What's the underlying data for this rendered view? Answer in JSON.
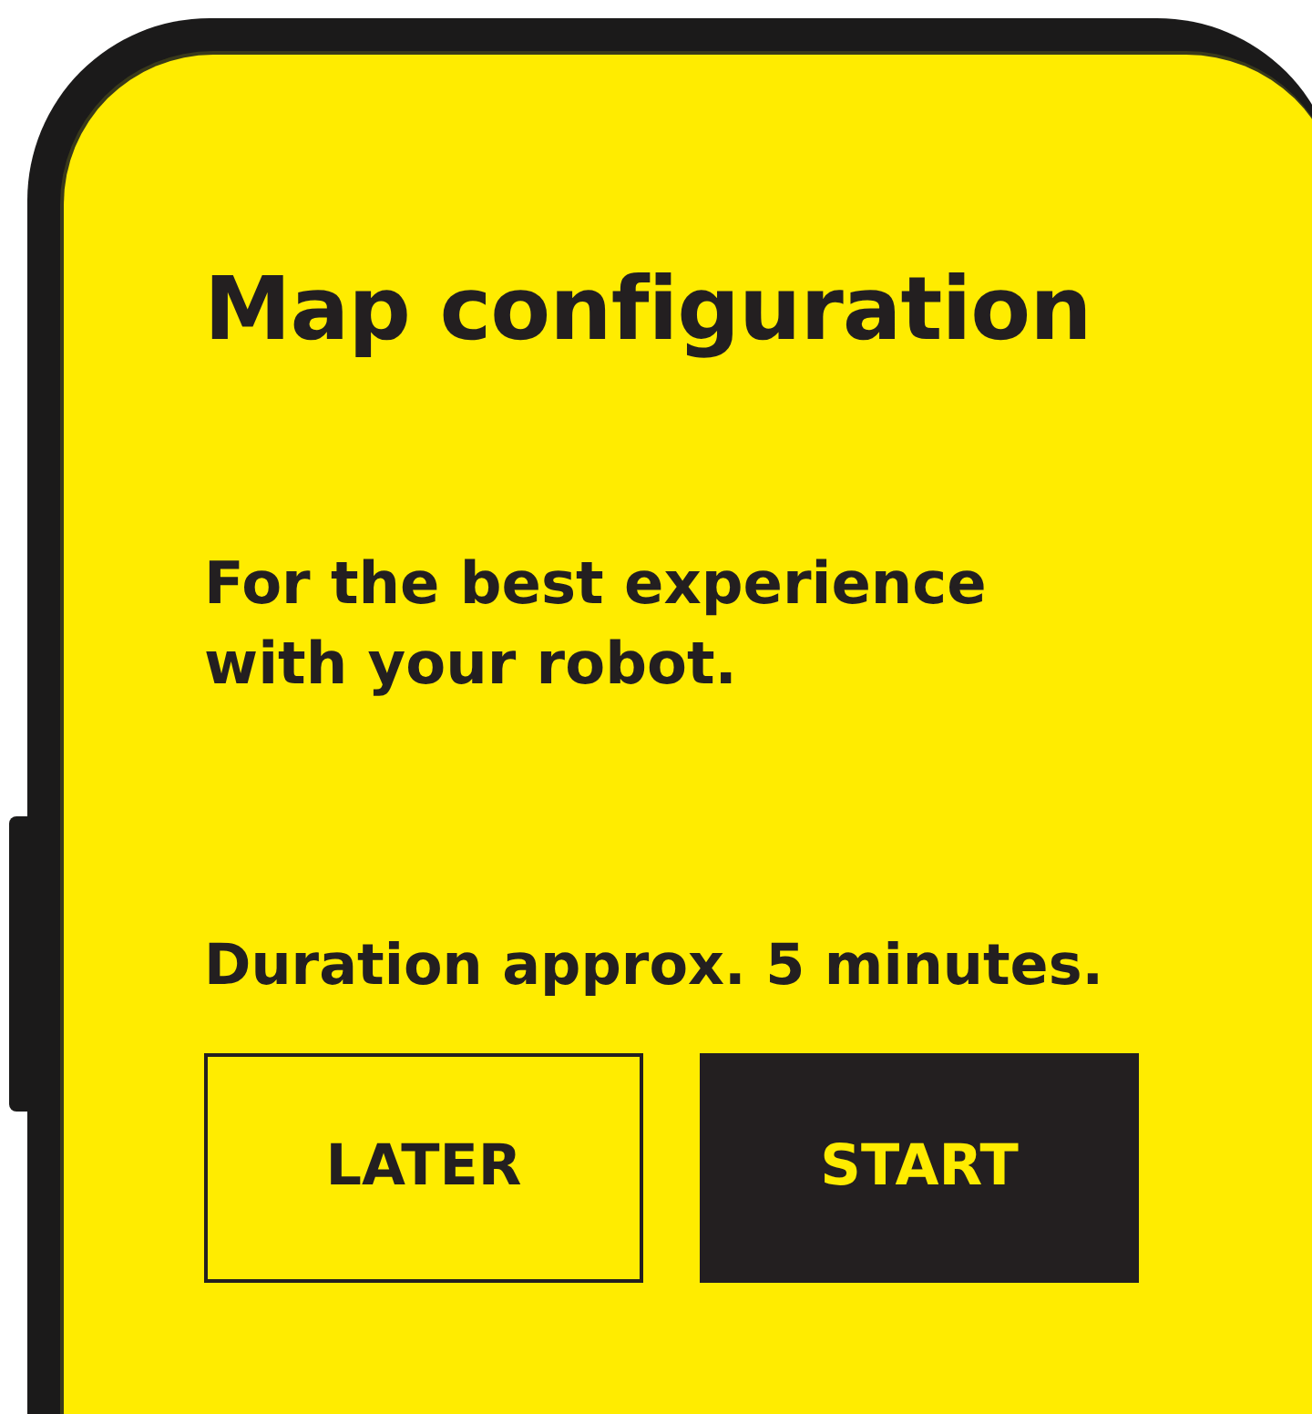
{
  "screen": {
    "title": "Map configuration",
    "description": "For the best experience with your robot.",
    "duration": "Duration approx. 5 minutes.",
    "buttons": [
      {
        "label": "LATER",
        "kind": "outline"
      },
      {
        "label": "START",
        "kind": "filled"
      }
    ]
  }
}
